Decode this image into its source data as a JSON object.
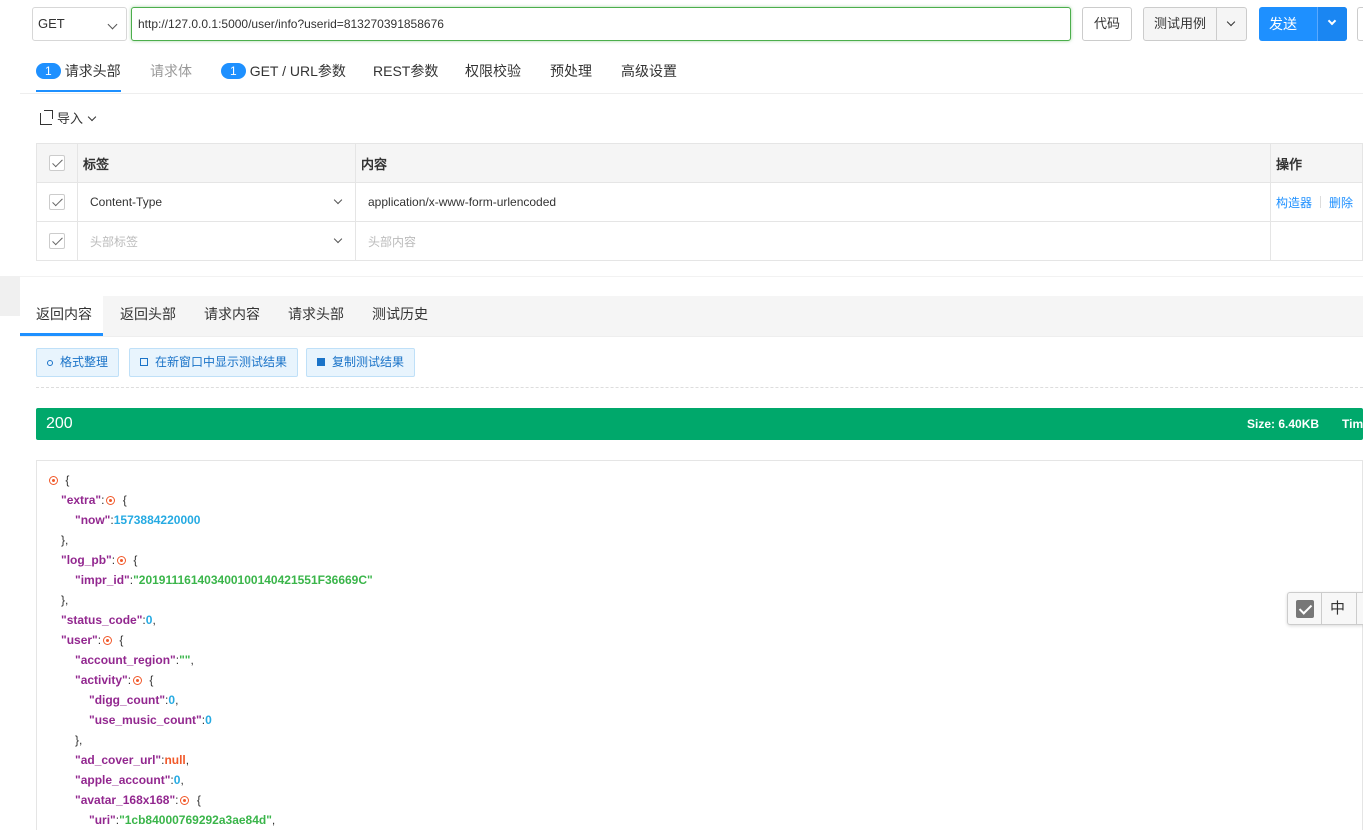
{
  "request": {
    "method": "GET",
    "url": "http://127.0.0.1:5000/user/info?userid=813270391858676",
    "code_label": "代码",
    "test_case_label": "测试用例",
    "send_label": "发送"
  },
  "request_tabs": [
    {
      "badge": "1",
      "label": "请求头部"
    },
    {
      "label": "请求体"
    },
    {
      "badge": "1",
      "label": "GET / URL参数"
    },
    {
      "label": "REST参数"
    },
    {
      "label": "权限校验"
    },
    {
      "label": "预处理"
    },
    {
      "label": "高级设置"
    }
  ],
  "headers_panel": {
    "import_label": "导入",
    "columns": {
      "label": "标签",
      "content": "内容",
      "actions": "操作"
    },
    "rows": [
      {
        "label": "Content-Type",
        "content": "application/x-www-form-urlencoded",
        "builder": "构造器",
        "delete": "删除"
      }
    ],
    "placeholder": {
      "label": "头部标签",
      "content": "头部内容"
    }
  },
  "response_tabs": [
    "返回内容",
    "返回头部",
    "请求内容",
    "请求头部",
    "测试历史"
  ],
  "response_tools": [
    "格式整理",
    "在新窗口中显示测试结果",
    "复制测试结果"
  ],
  "status": {
    "code": "200",
    "size": "Size: 6.40KB",
    "time": "Time"
  },
  "json_keys": {
    "extra": "\"extra\"",
    "now": "\"now\"",
    "log_pb": "\"log_pb\"",
    "impr_id": "\"impr_id\"",
    "status_code": "\"status_code\"",
    "user": "\"user\"",
    "account_region": "\"account_region\"",
    "activity": "\"activity\"",
    "digg_count": "\"digg_count\"",
    "use_music_count": "\"use_music_count\"",
    "ad_cover_url": "\"ad_cover_url\"",
    "apple_account": "\"apple_account\"",
    "avatar_168x168": "\"avatar_168x168\"",
    "uri": "\"uri\""
  },
  "json_values": {
    "now": "1573884220000",
    "impr_id": "\"2019111614034001001404215 51F36669C\"",
    "status_code": "0",
    "account_region": "\"\"",
    "digg_count": "0",
    "use_music_count": "0",
    "ad_cover_url": "null",
    "apple_account": "0",
    "uri": "\"1cb84000769292a3ae84d\""
  },
  "float_tool": {
    "lang": "中"
  }
}
